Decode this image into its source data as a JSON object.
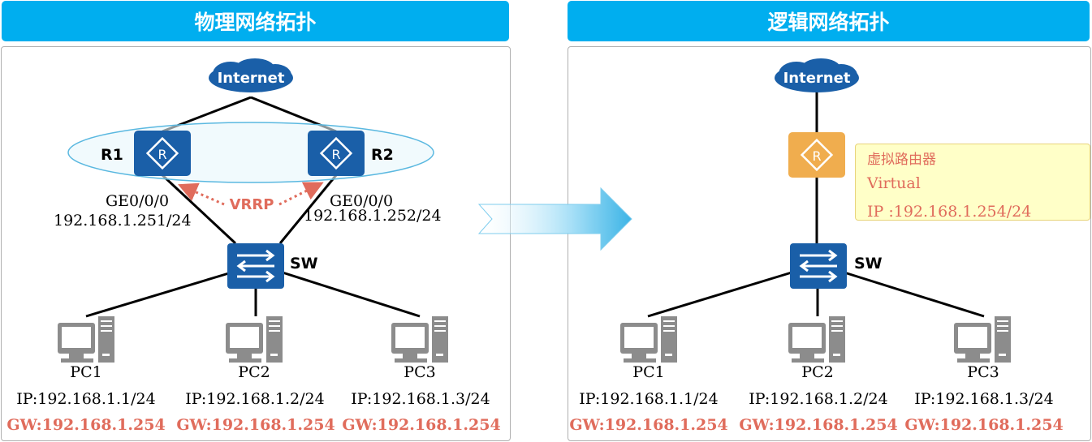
{
  "left_panel": {
    "title": "物理网络拓扑"
  },
  "right_panel": {
    "title": "逻辑网络拓扑"
  },
  "internet_label": "Internet",
  "routers": {
    "r1": {
      "name": "R1",
      "interface": "GE0/0/0",
      "ip": "192.168.1.251/24"
    },
    "r2": {
      "name": "R2",
      "interface": "GE0/0/0",
      "ip": "192.168.1.252/24"
    }
  },
  "vrrp_label": "VRRP",
  "switch_label": "SW",
  "virtual_router": {
    "line1": "虚拟路由器",
    "line2": "Virtual",
    "line3": "IP :192.168.1.254/24"
  },
  "pcs": [
    {
      "name": "PC1",
      "ip": "IP:192.168.1.1/24",
      "gw": "GW:192.168.1.254"
    },
    {
      "name": "PC2",
      "ip": "IP:192.168.1.2/24",
      "gw": "GW:192.168.1.254"
    },
    {
      "name": "PC3",
      "ip": "IP:192.168.1.3/24",
      "gw": "GW:192.168.1.254"
    }
  ],
  "colors": {
    "header_blue": "#00aeef",
    "device_blue": "#1a5fa8",
    "virtual_orange": "#f0ad4e",
    "accent_red": "#e06c5c"
  }
}
